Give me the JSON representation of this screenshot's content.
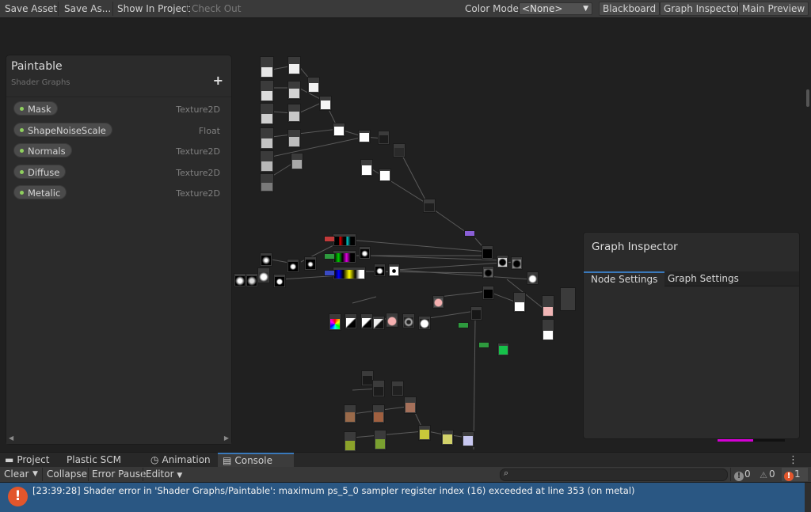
{
  "toolbar": {
    "save_asset": "Save Asset",
    "save_as": "Save As...",
    "show_in_project": "Show In Project",
    "check_out": "Check Out",
    "color_mode_label": "Color Mode",
    "color_mode_value": "<None>",
    "blackboard": "Blackboard",
    "graph_inspector": "Graph Inspector",
    "main_preview": "Main Preview"
  },
  "blackboard": {
    "title": "Paintable",
    "subtitle": "Shader Graphs",
    "add_icon": "+",
    "properties": [
      {
        "name": "Mask",
        "type": "Texture2D"
      },
      {
        "name": "ShapeNoiseScale",
        "type": "Float"
      },
      {
        "name": "Normals",
        "type": "Texture2D"
      },
      {
        "name": "Diffuse",
        "type": "Texture2D"
      },
      {
        "name": "Metalic",
        "type": "Texture2D"
      }
    ]
  },
  "inspector": {
    "title": "Graph Inspector",
    "tabs": [
      "Node Settings",
      "Graph Settings"
    ],
    "active_tab": "Node Settings"
  },
  "panel_tabs": {
    "project": "Project",
    "plastic": "Plastic SCM",
    "animation": "Animation",
    "console": "Console"
  },
  "console": {
    "clear": "Clear",
    "collapse": "Collapse",
    "error_pause": "Error Pause",
    "editor": "Editor",
    "search_placeholder": "",
    "log_count": "0",
    "warning_count": "0",
    "error_count": "1",
    "message": "[23:39:28] Shader error in 'Shader Graphs/Paintable': maximum ps_5_0 sampler register index (16) exceeded at line 353 (on metal)"
  },
  "colors": {
    "accent": "#3a79bb",
    "error": "#e2562c",
    "selected_log": "#2a5783",
    "property_dot": "#8fd05e"
  }
}
